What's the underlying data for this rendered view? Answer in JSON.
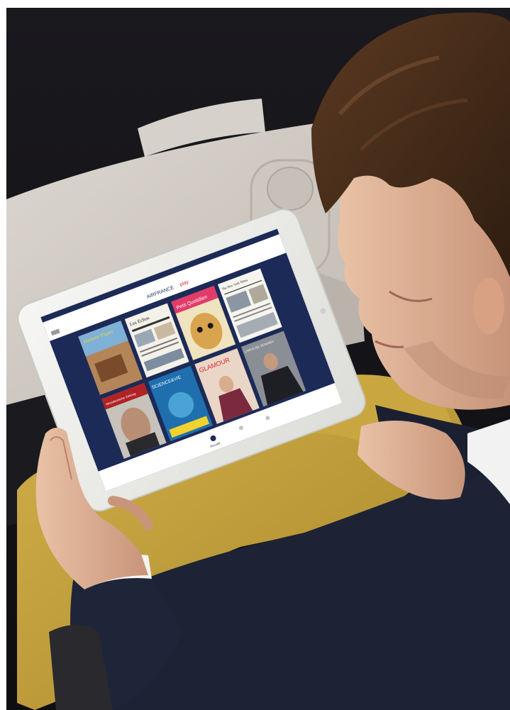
{
  "app": {
    "brand_prefix": "AIRFRANCE",
    "brand_suffix": "play"
  },
  "publications": [
    {
      "title": "Madame Figaro"
    },
    {
      "title": "Les Echos"
    },
    {
      "title": "Petit Quotidien"
    },
    {
      "title": "The New York Times"
    },
    {
      "title": "Westdeutsche Zeitung"
    },
    {
      "title": "SCIENCE&VIE"
    },
    {
      "title": "GLAMOUR"
    },
    {
      "title": "L'OFFICIEL HOMMES"
    }
  ],
  "tabbar": {
    "home_label": "Accueil"
  },
  "colors": {
    "screen_background": "#1c2a57",
    "tablet_body": "#eeeeec",
    "pants": "#c5a33a",
    "sweater": "#1d2335"
  }
}
